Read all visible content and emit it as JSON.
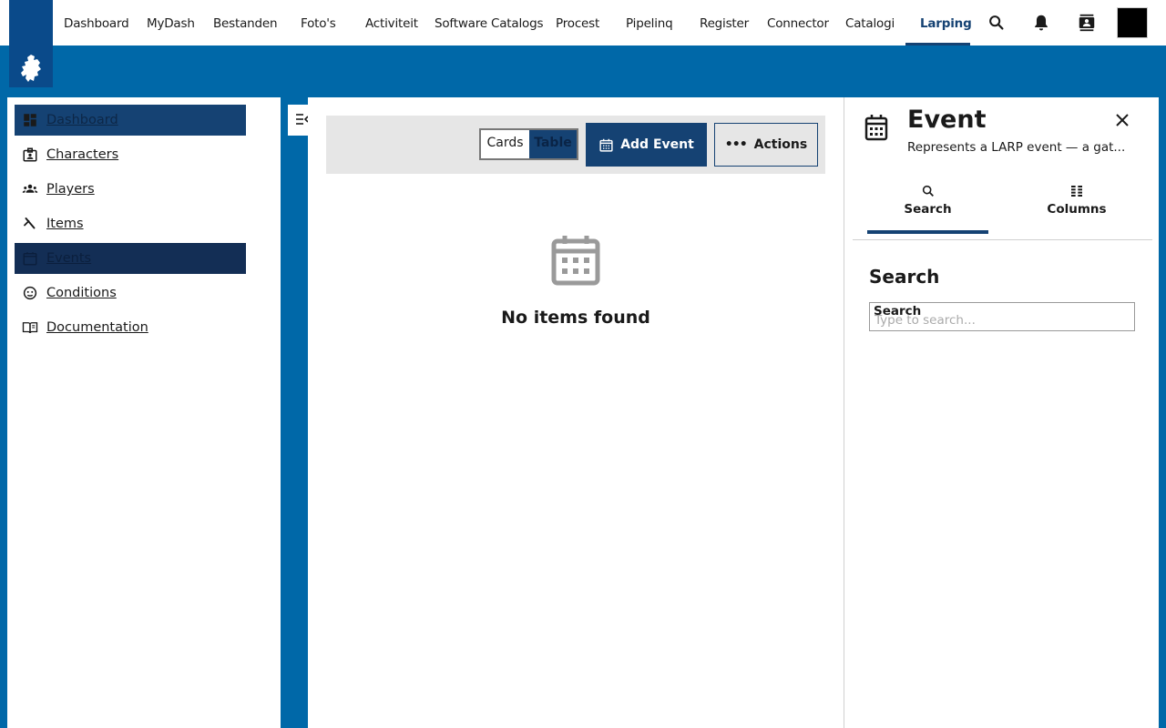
{
  "topnav": {
    "items": [
      "Dashboard",
      "MyDash",
      "Bestanden",
      "Foto's",
      "Activiteit",
      "Software Catalogs",
      "Procest",
      "Pipelinq",
      "Register",
      "Connector",
      "Catalogi",
      "Larping"
    ],
    "active": "Larping",
    "icons": [
      "search-icon",
      "bell-icon",
      "contacts-icon"
    ]
  },
  "sidebar": {
    "items": [
      {
        "label": "Dashboard",
        "icon": "dashboard-icon"
      },
      {
        "label": "Characters",
        "icon": "badge-icon"
      },
      {
        "label": "Players",
        "icon": "group-icon"
      },
      {
        "label": "Items",
        "icon": "sword-icon"
      },
      {
        "label": "Events",
        "icon": "calendar-icon"
      },
      {
        "label": "Conditions",
        "icon": "face-icon"
      },
      {
        "label": "Documentation",
        "icon": "book-icon"
      }
    ]
  },
  "toolbar": {
    "view_cards": "Cards",
    "view_table": "Table",
    "add_label": "Add Event",
    "actions_label": "Actions"
  },
  "main": {
    "empty_text": "No items found"
  },
  "panel": {
    "title": "Event",
    "subtitle": "Represents a LARP event — a gat...",
    "tab_search": "Search",
    "tab_columns": "Columns",
    "section_title": "Search",
    "input_label": "Search",
    "input_placeholder": "Type to search..."
  },
  "colors": {
    "brand": "#154273",
    "background": "#0068a8"
  }
}
